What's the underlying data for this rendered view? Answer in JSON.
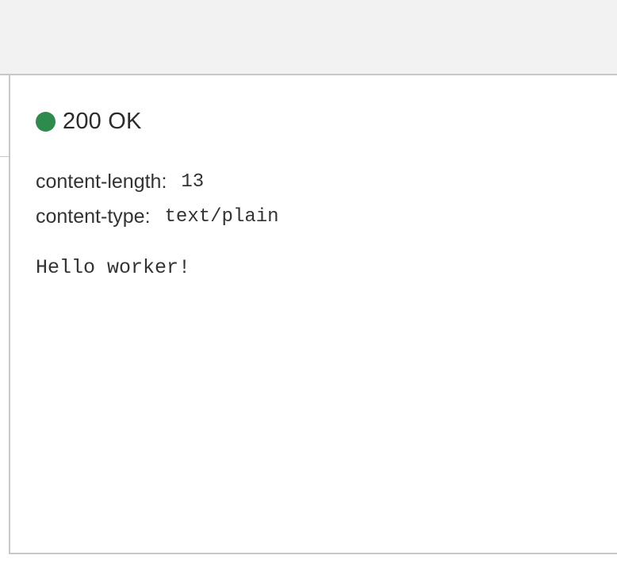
{
  "response": {
    "status": {
      "text": "200 OK",
      "color": "#2e8b4e",
      "indicator_icon": "status-dot-icon"
    },
    "headers": [
      {
        "key": "content-length:",
        "value": "13"
      },
      {
        "key": "content-type:",
        "value": "text/plain"
      }
    ],
    "body": "Hello worker!"
  },
  "colors": {
    "topbar_background": "#f2f2f2",
    "border": "#c8c8c8",
    "text": "#333333"
  }
}
